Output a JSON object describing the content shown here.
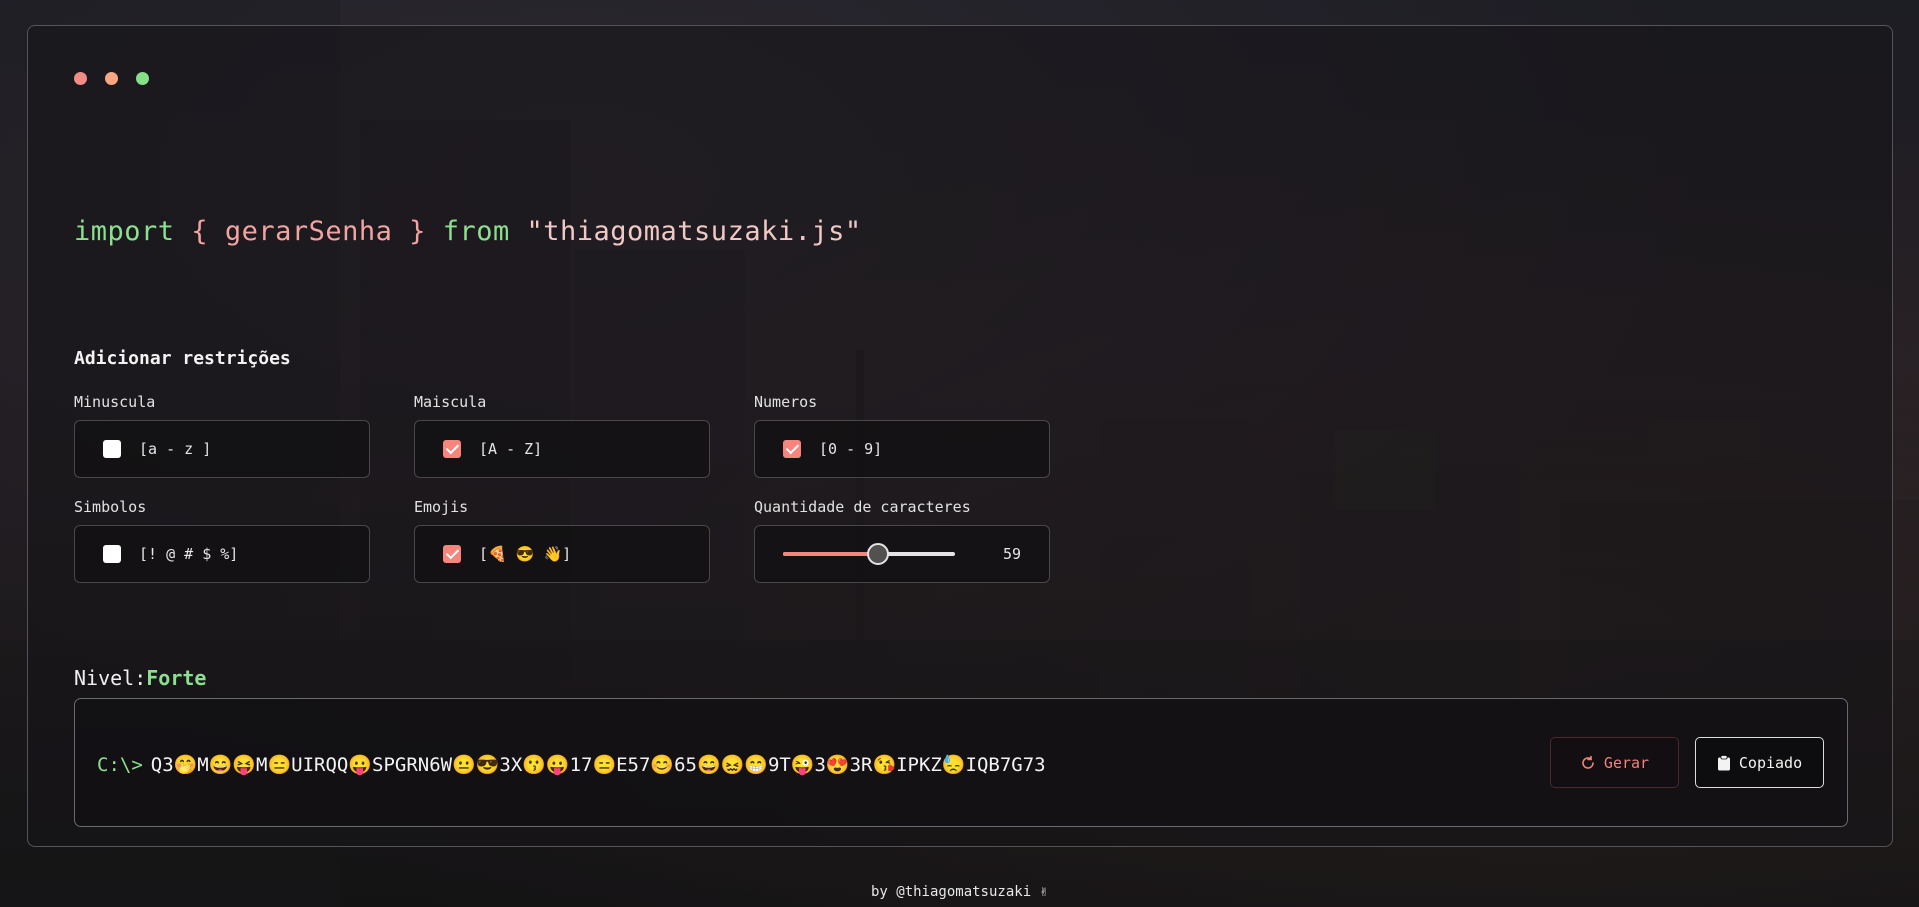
{
  "import_line": {
    "import_kw": "import",
    "brace_open": "{",
    "fn_name": "gerarSenha",
    "brace_close": "}",
    "from_kw": "from",
    "module": "\"thiagomatsuzaki.js\""
  },
  "restrictions": {
    "title": "Adicionar restrições",
    "lowercase": {
      "label": "Minuscula",
      "range": "[a - z ]",
      "checked": false
    },
    "uppercase": {
      "label": "Maiscula",
      "range": "[A - Z]",
      "checked": true
    },
    "numbers": {
      "label": "Numeros",
      "range": "[0 - 9]",
      "checked": true
    },
    "symbols": {
      "label": "Simbolos",
      "range": "[! @ # $ %]",
      "checked": false
    },
    "emojis": {
      "label": "Emojis",
      "range": "[🍕 😎 👋]",
      "checked": true
    },
    "length": {
      "label": "Quantidade de caracteres",
      "value": "59",
      "fraction": 0.55
    }
  },
  "level": {
    "label": "Nivel:",
    "value": "Forte"
  },
  "output": {
    "prompt": "C:\\>",
    "password": "Q3🤭M😄😝M😑UIRQQ😛SPGRN6W😐😎3X😗😛17😑E57😊65😄😖😁9T😜3😍3R😘IPKZ😓IQB7G73"
  },
  "buttons": {
    "generate": "Gerar",
    "copy": "Copiado"
  },
  "footer": "by @thiagomatsuzaki ✌",
  "colors": {
    "accent": "#f5857d",
    "green": "#8be08f"
  }
}
